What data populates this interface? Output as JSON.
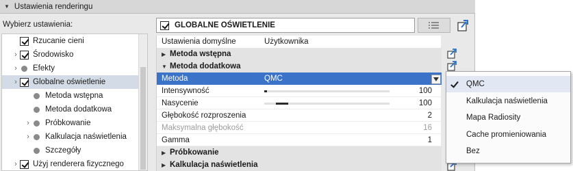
{
  "header": {
    "title": "Ustawienia renderingu"
  },
  "choose_label": "Wybierz ustawienia:",
  "tree": [
    {
      "label": "Rzucanie cieni",
      "kind": "checkbox",
      "checked": true,
      "chevron": false
    },
    {
      "label": "Środowisko",
      "kind": "checkbox",
      "checked": true,
      "chevron": true
    },
    {
      "label": "Efekty",
      "kind": "dot",
      "chevron": true
    },
    {
      "label": "Globalne oświetlenie",
      "kind": "checkbox",
      "checked": true,
      "chevron": true,
      "selected": true
    },
    {
      "label": "Metoda wstępna",
      "kind": "dot",
      "chevron": false
    },
    {
      "label": "Metoda dodatkowa",
      "kind": "dot",
      "chevron": false
    },
    {
      "label": "Próbkowanie",
      "kind": "dot",
      "chevron": true
    },
    {
      "label": "Kalkulacja naświetlenia",
      "kind": "dot",
      "chevron": true
    },
    {
      "label": "Szczegóły",
      "kind": "dot",
      "chevron": false
    },
    {
      "label": "Użyj renderera fizycznego",
      "kind": "checkbox",
      "checked": true,
      "chevron": true
    }
  ],
  "group_bar": {
    "title": "GLOBALNE OŚWIETLENIE",
    "checked": true
  },
  "settings": {
    "defaults_label": "Ustawienia domyślne",
    "defaults_value": "Użytkownika",
    "sec_pre": "Metoda wstępna",
    "sec_add": "Metoda dodatkowa",
    "method_label": "Metoda",
    "method_value": "QMC",
    "intensity_label": "Intensywność",
    "intensity_value": "100",
    "saturation_label": "Nasycenie",
    "saturation_value": "100",
    "diffuse_label": "Głębokość rozproszenia",
    "diffuse_value": "2",
    "maxdepth_label": "Maksymalna głębokość",
    "maxdepth_value": "16",
    "gamma_label": "Gamma",
    "gamma_value": "1",
    "sec_sampling": "Próbkowanie",
    "sec_lighting": "Kalkulacja naświetlenia"
  },
  "sliders": {
    "intensity": 0.02,
    "saturation": 0.1
  },
  "dropdown": {
    "options": [
      "QMC",
      "Kalkulacja naświetlenia",
      "Mapa Radiosity",
      "Cache promieniowania",
      "Bez"
    ],
    "selected_index": 0
  },
  "colors": {
    "highlight": "#3b73c8",
    "accent_icon": "#2a6fc9"
  },
  "icons": [
    "list-settings-icon",
    "export-icon",
    "checkmark-icon",
    "chevron-down-icon",
    "chevron-right-icon"
  ]
}
